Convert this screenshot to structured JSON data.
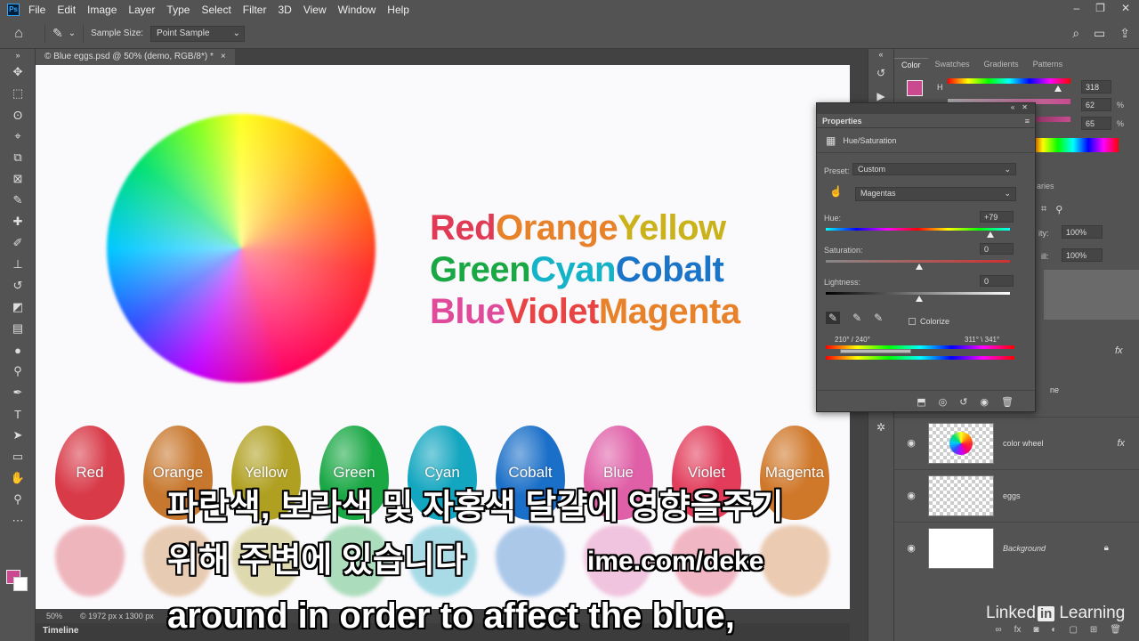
{
  "menubar": {
    "app_icon": "Ps",
    "items": [
      "File",
      "Edit",
      "Image",
      "Layer",
      "Type",
      "Select",
      "Filter",
      "3D",
      "View",
      "Window",
      "Help"
    ],
    "window_controls": [
      "–",
      "❐",
      "✕"
    ]
  },
  "options": {
    "home_icon": "home-icon",
    "sample_size_label": "Sample Size:",
    "sample_size_value": "Point Sample"
  },
  "document": {
    "tab_title": "© Blue eggs.psd @ 50% (demo, RGB/8*) *",
    "close": "×",
    "zoom": "50%",
    "doc_size": "© 1972 px x 1300 px",
    "timeline_label": "Timeline"
  },
  "canvas": {
    "word_lines": [
      [
        {
          "text": "Red",
          "color": "#e03a55"
        },
        {
          "text": "Orange",
          "color": "#e8822a"
        },
        {
          "text": "Yellow",
          "color": "#c9b21a"
        }
      ],
      [
        {
          "text": "Green",
          "color": "#1aa845"
        },
        {
          "text": "Cyan",
          "color": "#14b3c8"
        },
        {
          "text": "Cobalt",
          "color": "#1a74c8"
        }
      ],
      [
        {
          "text": "Blue",
          "color": "#e04a9a"
        },
        {
          "text": "Violet",
          "color": "#e84444"
        },
        {
          "text": "Magenta",
          "color": "#e8822a"
        }
      ]
    ],
    "eggs": [
      {
        "label": "Red",
        "color": "#d83a48"
      },
      {
        "label": "Orange",
        "color": "#c8782e"
      },
      {
        "label": "Yellow",
        "color": "#b0a022"
      },
      {
        "label": "Green",
        "color": "#1aa845"
      },
      {
        "label": "Cyan",
        "color": "#12a6c0"
      },
      {
        "label": "Cobalt",
        "color": "#1a6fc8"
      },
      {
        "label": "Blue",
        "color": "#e060a8"
      },
      {
        "label": "Violet",
        "color": "#e23c5a"
      },
      {
        "label": "Magenta",
        "color": "#d0782a"
      }
    ]
  },
  "color_panel": {
    "tabs": [
      "Color",
      "Swatches",
      "Gradients",
      "Patterns"
    ],
    "active_tab": "Color",
    "h_label": "H",
    "h_value": "318",
    "s_value": "62",
    "b_value": "65",
    "pct": "%",
    "swatch_color": "#c94a8f"
  },
  "layers_panel": {
    "tab_partial": "aries",
    "opacity": "100%",
    "opacity_label": "ity:",
    "fill": "100%",
    "fill_label": "ill:",
    "layers": [
      {
        "name": "color wheel",
        "italic": false
      },
      {
        "name": "eggs",
        "italic": false
      },
      {
        "name": "Background",
        "italic": true
      }
    ],
    "partial_name": "ne"
  },
  "properties": {
    "title": "Properties",
    "type": "Hue/Saturation",
    "preset_label": "Preset:",
    "preset_value": "Custom",
    "channel_value": "Magentas",
    "hue_label": "Hue:",
    "hue_value": "+79",
    "hue_level": 0.79,
    "saturation_label": "Saturation:",
    "saturation_value": "0",
    "lightness_label": "Lightness:",
    "lightness_value": "0",
    "colorize_label": "Colorize",
    "range_left": "210° / 240°",
    "range_right": "311° \\ 341°"
  },
  "subtitles": {
    "korean_1": "파란색, 보라색 및 자홍색 달걀에 영향을주기",
    "korean_2": "위해 주변에 있습니다",
    "watermark": "ime.com/deke",
    "english": "around in order to affect the blue,"
  },
  "branding": {
    "linkedin_prefix": "Linked",
    "linkedin_in": "in",
    "linkedin_suffix": "Learning"
  }
}
